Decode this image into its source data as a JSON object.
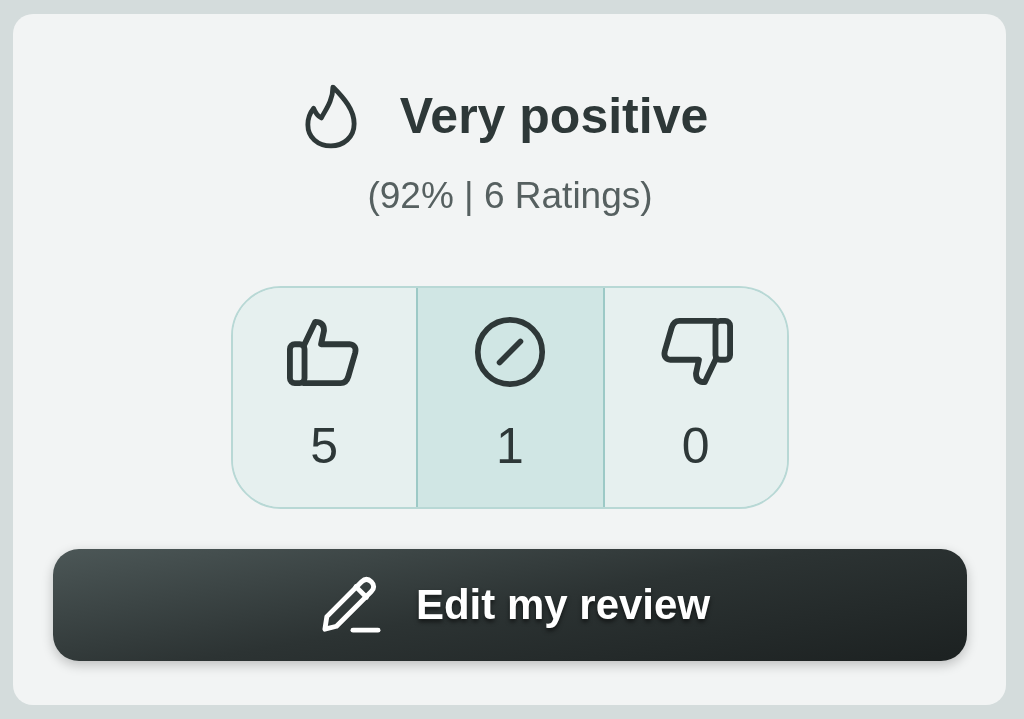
{
  "rating": {
    "label": "Very positive",
    "summary": "(92% | 6 Ratings)"
  },
  "votes": [
    {
      "kind": "up",
      "count": "5",
      "selected": false
    },
    {
      "kind": "neutral",
      "count": "1",
      "selected": true
    },
    {
      "kind": "down",
      "count": "0",
      "selected": false
    }
  ],
  "edit_button": {
    "label": "Edit my review"
  }
}
